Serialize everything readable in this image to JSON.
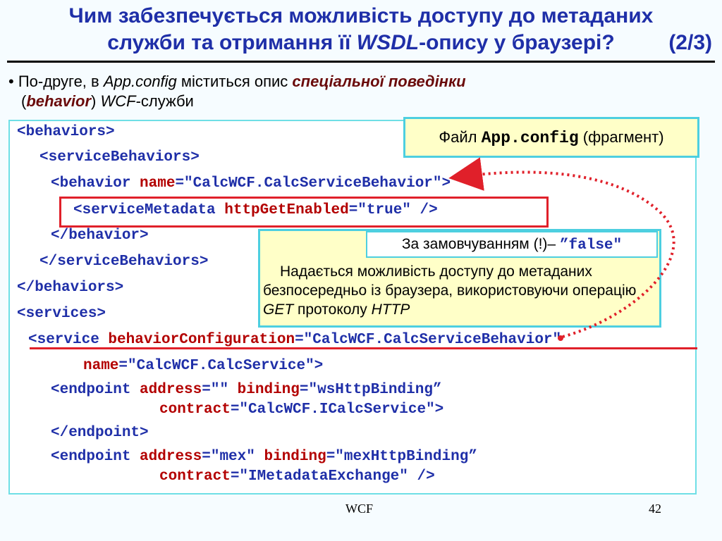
{
  "title": {
    "line1": "Чим забезпечується можливість доступу до метаданих",
    "line2_before": "служби та отримання її ",
    "line2_wsdl": "WSDL",
    "line2_after": "-опису у браузері?",
    "fraction": "(2/3)"
  },
  "bullet": {
    "mark": "•",
    "t1": "По-друге, в ",
    "appconfig": "App.config",
    "t2": " міститься опис ",
    "special": "спеціальної поведінки",
    "paren_open": "(",
    "behavior": "behavior",
    "paren_close": ") ",
    "wcf": "WCF",
    "suffix": "-служби"
  },
  "file_label": {
    "prefix": "Файл ",
    "name": "App.config",
    "suffix": " (фрагмент)"
  },
  "default_note": {
    "text": "За замовчуванням (!)– ",
    "value": "”false\""
  },
  "description": {
    "t1": "Надається можливість доступу до метаданих безпосередньо із браузера, використовуючи операцію ",
    "get": "GET",
    "t2": " протоколу ",
    "http": "HTTP"
  },
  "code": {
    "l1": "<behaviors>",
    "l2": "<serviceBehaviors>",
    "l3_tag": "<behavior ",
    "l3_attr": "name",
    "l3_val": "=\"CalcWCF.CalcServiceBehavior\">",
    "l4_tag": "<serviceMetadata ",
    "l4_attr": "httpGetEnabled",
    "l4_val": "=\"true\" />",
    "l5": "</behavior>",
    "l6": "</serviceBehaviors>",
    "l7": "</behaviors>",
    "l8": "<services>",
    "l9_tag": "<service ",
    "l9_attr": "behaviorConfiguration",
    "l9_val": "=\"CalcWCF.CalcServiceBehavior\"",
    "l10_attr": "name",
    "l10_val": "=\"CalcWCF.CalcService\">",
    "l11_tag": "<endpoint ",
    "l11_attr1": "address",
    "l11_val1": "=\"\" ",
    "l11_attr2": "binding",
    "l11_val2": "=\"wsHttpBinding”",
    "l12_attr": "contract",
    "l12_val": "=\"CalcWCF.ICalcService\">",
    "l13": "</endpoint>",
    "l14_tag": "<endpoint ",
    "l14_attr1": "address",
    "l14_val1": "=\"mex\" ",
    "l14_attr2": "binding",
    "l14_val2": "=\"mexHttpBinding”",
    "l15_attr": "contract",
    "l15_val": "=\"IMetadataExchange\" />"
  },
  "footer": {
    "center": "WCF",
    "page": "42"
  },
  "colors": {
    "title": "#1f2fa8",
    "accent_red": "#e0202a",
    "box_fill": "#ffffc8",
    "box_border": "#4dcfe0"
  }
}
